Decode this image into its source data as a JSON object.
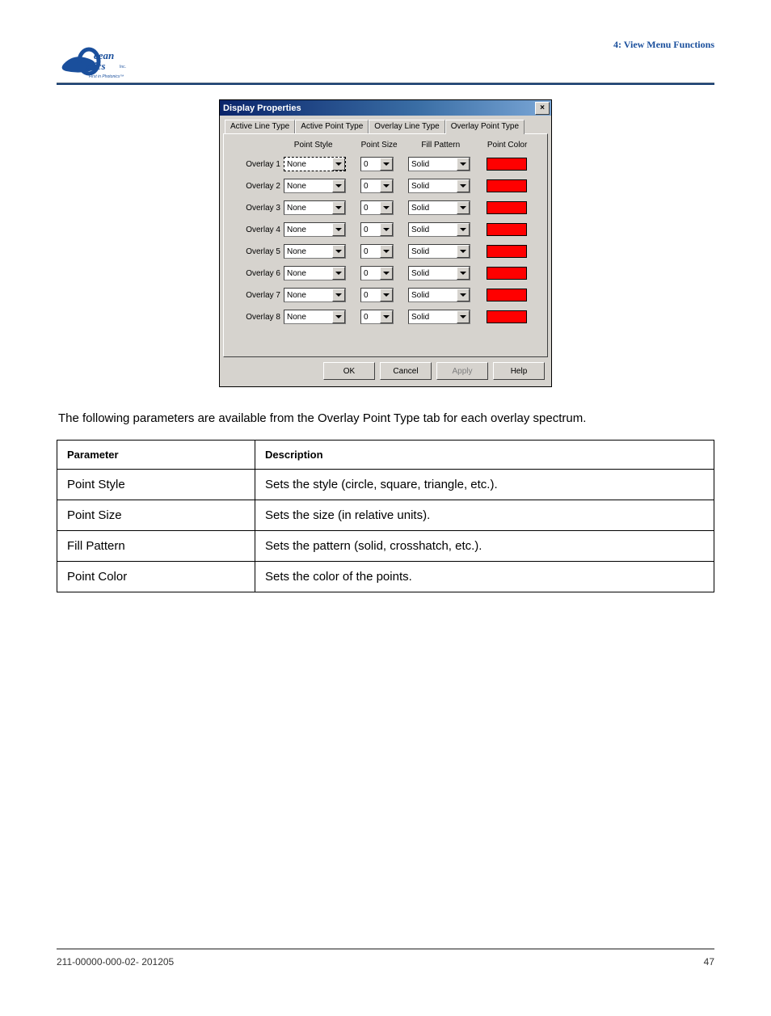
{
  "header": {
    "chapter": "4: View Menu Functions"
  },
  "dialog": {
    "title": "Display Properties",
    "tabs": [
      "Active Line Type",
      "Active Point Type",
      "Overlay Line Type",
      "Overlay Point Type"
    ],
    "active_tab": 3,
    "columns": [
      "Point Style",
      "Point Size",
      "Fill Pattern",
      "Point Color"
    ],
    "rows": [
      {
        "label": "Overlay 1",
        "style": "None",
        "size": "0",
        "fill": "Solid",
        "color": "#ff0000",
        "selected": true
      },
      {
        "label": "Overlay 2",
        "style": "None",
        "size": "0",
        "fill": "Solid",
        "color": "#ff0000"
      },
      {
        "label": "Overlay 3",
        "style": "None",
        "size": "0",
        "fill": "Solid",
        "color": "#ff0000"
      },
      {
        "label": "Overlay 4",
        "style": "None",
        "size": "0",
        "fill": "Solid",
        "color": "#ff0000"
      },
      {
        "label": "Overlay 5",
        "style": "None",
        "size": "0",
        "fill": "Solid",
        "color": "#ff0000"
      },
      {
        "label": "Overlay 6",
        "style": "None",
        "size": "0",
        "fill": "Solid",
        "color": "#ff0000"
      },
      {
        "label": "Overlay 7",
        "style": "None",
        "size": "0",
        "fill": "Solid",
        "color": "#ff0000"
      },
      {
        "label": "Overlay 8",
        "style": "None",
        "size": "0",
        "fill": "Solid",
        "color": "#ff0000"
      }
    ],
    "buttons": {
      "ok": "OK",
      "cancel": "Cancel",
      "apply": "Apply",
      "help": "Help"
    }
  },
  "intro": "The following parameters are available from the Overlay Point Type tab for each overlay spectrum.",
  "table": {
    "head": {
      "param": "Parameter",
      "desc": "Description"
    },
    "rows": [
      {
        "param": "Point Style",
        "desc": "Sets the style (circle, square, triangle, etc.)."
      },
      {
        "param": "Point Size",
        "desc": "Sets the size (in relative units)."
      },
      {
        "param": "Fill Pattern",
        "desc": "Sets the pattern (solid, crosshatch, etc.)."
      },
      {
        "param": "Point Color",
        "desc": "Sets the color of the points."
      }
    ]
  },
  "footer": {
    "doc": "211-00000-000-02- 201205",
    "page": "47"
  }
}
